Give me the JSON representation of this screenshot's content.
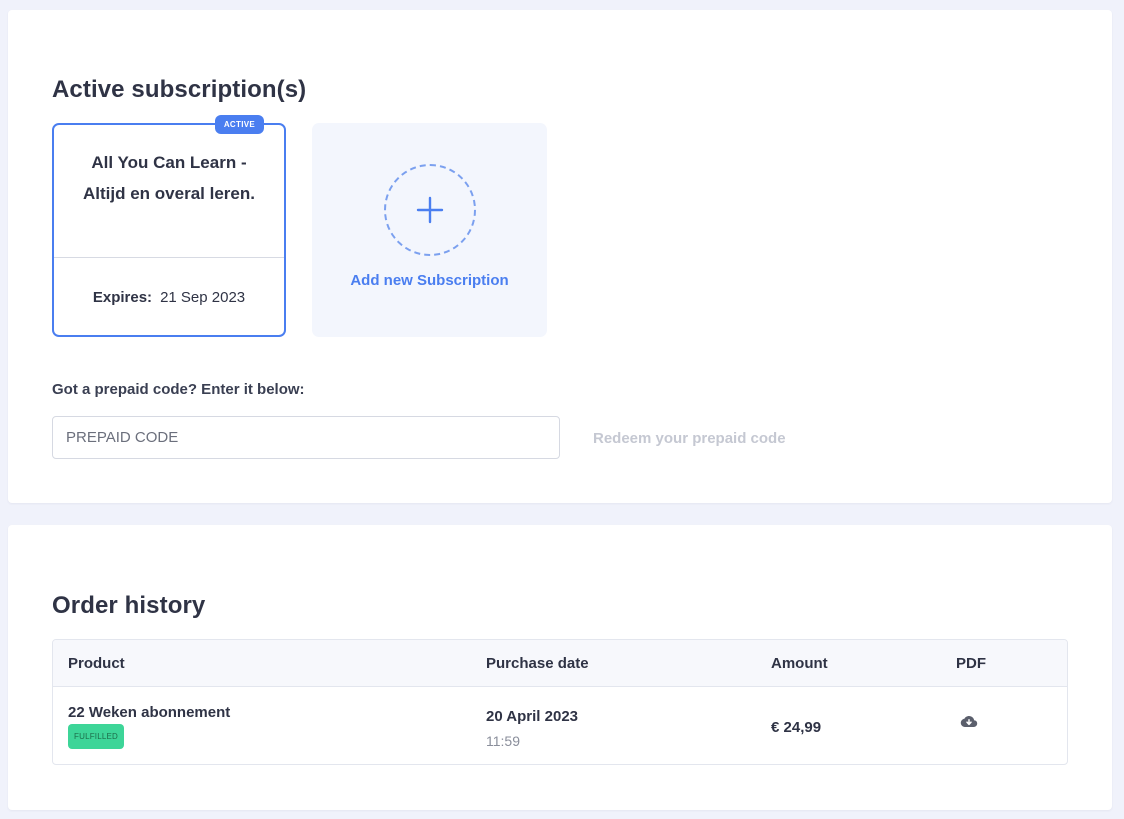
{
  "subscriptions": {
    "title": "Active subscription(s)",
    "card": {
      "badge": "ACTIVE",
      "name": "All You Can Learn - Altijd en overal leren.",
      "expires_label": "Expires:",
      "expires_value": "21 Sep 2023"
    },
    "add_new_label": "Add new Subscription",
    "add_icon": "plus-icon",
    "prepaid": {
      "label": "Got a prepaid code? Enter it below:",
      "placeholder": "PREPAID CODE",
      "value": "",
      "redeem_label": "Redeem your prepaid code"
    }
  },
  "orders": {
    "title": "Order history",
    "columns": [
      "Product",
      "Purchase date",
      "Amount",
      "PDF"
    ],
    "rows": [
      {
        "product": "22 Weken abonnement",
        "status": "FULFILLED",
        "date": "20 April 2023",
        "time": "11:59",
        "amount": "€ 24,99",
        "pdf_icon": "cloud-download-icon"
      }
    ]
  },
  "colors": {
    "accent": "#4a7ef0",
    "fulfilled": "#3dd598",
    "background": "#f0f2fb"
  }
}
